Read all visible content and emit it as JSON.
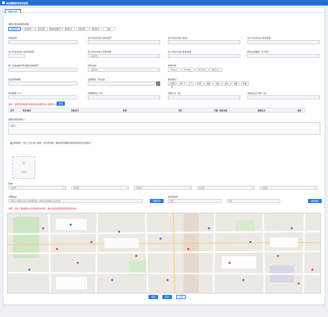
{
  "window": {
    "title": "添加健康养老机构信息"
  },
  "tabs": [
    "基础信息"
  ],
  "form": {
    "service_type_label": "健康养老机构服务类型",
    "service_types": [
      "健康养老",
      "居家养老",
      "社区养老",
      "机构养老服务",
      "医养结合",
      "智慧养老",
      "旅居养老",
      "其他"
    ],
    "selected_service_type": 0,
    "row1": [
      "机构名称",
      "法人代表/负责人身份证号",
      "法人代表/负责人姓名",
      "法人代表/负责人联系电话"
    ],
    "row2": [
      "法人代表/负责人身份证类型",
      "法人代表/负责人证件类型",
      "法人代表/负责人联系电话",
      "机构占地面积（平方米）"
    ],
    "row2_values": [
      "",
      "--请选择--",
      "",
      ""
    ],
    "row3": [
      "统一社会信用代码/组织机构代码",
      "运营主体",
      "收费标准"
    ],
    "row3_values": [
      "",
      "--请选择--",
      ""
    ],
    "fee_options": [
      "50元以下",
      "50-100元",
      "100-200元",
      "200元以上"
    ],
    "row4_labels": [
      "建设用地类型",
      "设施类型（可多选）",
      "服务模式"
    ],
    "facility_btn": "选择",
    "service_modes": [
      "日间照料",
      "全托",
      "上门",
      "短托",
      "助餐",
      "助浴",
      "助洁",
      "助医",
      "其他"
    ],
    "row5": [
      "床位数量（个）",
      "护理型床位（张）",
      "护理人员（名）",
      "专职社会工作者（名）"
    ],
    "staff_notice": "提示：请按照表格填写本机构的主要负责人和服务人员信息",
    "staff_add_btn": "添加",
    "staff_cols": [
      "序号",
      "姓名/职务",
      "身份证号",
      "性别",
      "学历",
      "年龄",
      "联系电话",
      "资质证书",
      "操作"
    ],
    "intro_label": "健康养老机构简介",
    "intro_placeholder": "请输入",
    "photo_label": "机构照片（至少上传1张门头照、室内环境照、服务场景照等反映机构实际情况的照片）",
    "photo_agree": "上传照片",
    "region_label": "区域",
    "region_selects": [
      "请选择",
      "请选择",
      "请选择",
      "请选择",
      "请选择"
    ],
    "address_label": "详细地址",
    "address_placeholder": "请输入详细地址后点击地图定位，或直接在地图上点选位置",
    "locate_btn": "地图定位",
    "coord_label": "经纬度坐标",
    "lng_placeholder": "经度",
    "lat_placeholder": "纬度",
    "pick_btn": "选择坐标",
    "map_notice": "说明：请在下面地图中点击选择机构位置，确认后自动获取经纬度坐标信息"
  },
  "footer": {
    "buttons": [
      "保存",
      "提交",
      "关闭"
    ]
  },
  "colors": {
    "primary": "#2b7de0",
    "titlebar": "#1f6fd6",
    "required": "#e22233"
  }
}
